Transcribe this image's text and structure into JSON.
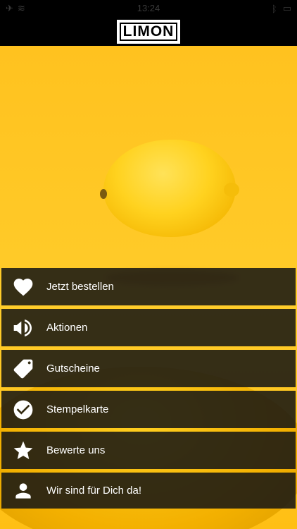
{
  "status_bar": {
    "time": "13:24"
  },
  "header": {
    "logo_text": "LIMON"
  },
  "menu": {
    "items": [
      {
        "label": "Jetzt bestellen",
        "icon": "heart-icon"
      },
      {
        "label": "Aktionen",
        "icon": "megaphone-icon"
      },
      {
        "label": "Gutscheine",
        "icon": "tag-icon"
      },
      {
        "label": "Stempelkarte",
        "icon": "check-circle-icon"
      },
      {
        "label": "Bewerte uns",
        "icon": "star-icon"
      },
      {
        "label": "Wir sind für Dich da!",
        "icon": "user-icon"
      }
    ]
  },
  "colors": {
    "accent": "#ffc21f",
    "menu_bg": "#141414",
    "header_bg": "#000000"
  }
}
